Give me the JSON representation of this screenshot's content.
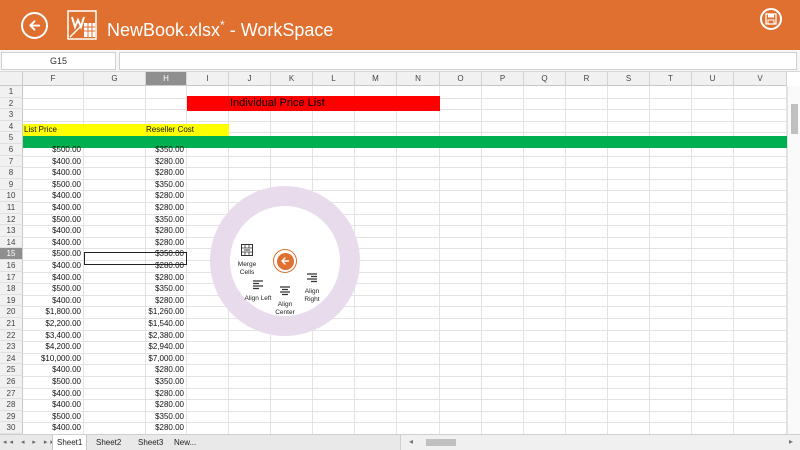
{
  "titlebar": {
    "filename": "NewBook.xlsx",
    "modified_mark": "*",
    "app_suffix": "- WorkSpace",
    "back_icon": "back-arrow-icon",
    "save_icon": "save-icon",
    "bg_color": "#e07030"
  },
  "formula_bar": {
    "name_box": "G15",
    "formula": ""
  },
  "columns": [
    "F",
    "G",
    "H",
    "I",
    "J",
    "K",
    "L",
    "M",
    "N",
    "O",
    "P",
    "Q",
    "R",
    "S",
    "T",
    "U",
    "V"
  ],
  "active_column": "H",
  "rows": [
    "1",
    "2",
    "3",
    "4",
    "5",
    "6",
    "7",
    "8",
    "9",
    "10",
    "11",
    "12",
    "13",
    "14",
    "15",
    "16",
    "17",
    "18",
    "19",
    "20",
    "21",
    "22",
    "23",
    "24",
    "25",
    "26",
    "27",
    "28",
    "29",
    "30"
  ],
  "active_row": "15",
  "title_cell": "Individual Price List",
  "headers": {
    "list_price": "List Price",
    "reseller_cost": "Reseller Cost"
  },
  "list_prices": [
    "$500.00",
    "$400.00",
    "$400.00",
    "$500.00",
    "$400.00",
    "$400.00",
    "$500.00",
    "$400.00",
    "$400.00",
    "$500.00",
    "$400.00",
    "$400.00",
    "$500.00",
    "$400.00",
    "$1,800.00",
    "$2,200.00",
    "$3,400.00",
    "$4,200.00",
    "$10,000.00",
    "$400.00",
    "$500.00",
    "$400.00",
    "$400.00",
    "$500.00",
    "$400.00"
  ],
  "reseller_costs": [
    "$350.00",
    "$280.00",
    "$280.00",
    "$350.00",
    "$280.00",
    "$280.00",
    "$350.00",
    "$280.00",
    "$280.00",
    "$350.00",
    "$280.00",
    "$280.00",
    "$350.00",
    "$280.00",
    "$1,260.00",
    "$1,540.00",
    "$2,380.00",
    "$2,940.00",
    "$7,000.00",
    "$280.00",
    "$350.00",
    "$280.00",
    "$280.00",
    "$350.00",
    "$280.00"
  ],
  "band_colors": {
    "title": "#ff0000",
    "header": "#ffff00",
    "separator": "#00b050"
  },
  "radial_menu": {
    "back_icon": "back-arrow-icon",
    "merge_cells": "Merge\nCells",
    "align_left": "Align Left",
    "align_center": "Align\nCenter",
    "align_right": "Align\nRight"
  },
  "sheet_tabs": [
    "Sheet1",
    "Sheet2",
    "Sheet3",
    "New..."
  ],
  "active_sheet": "Sheet1"
}
